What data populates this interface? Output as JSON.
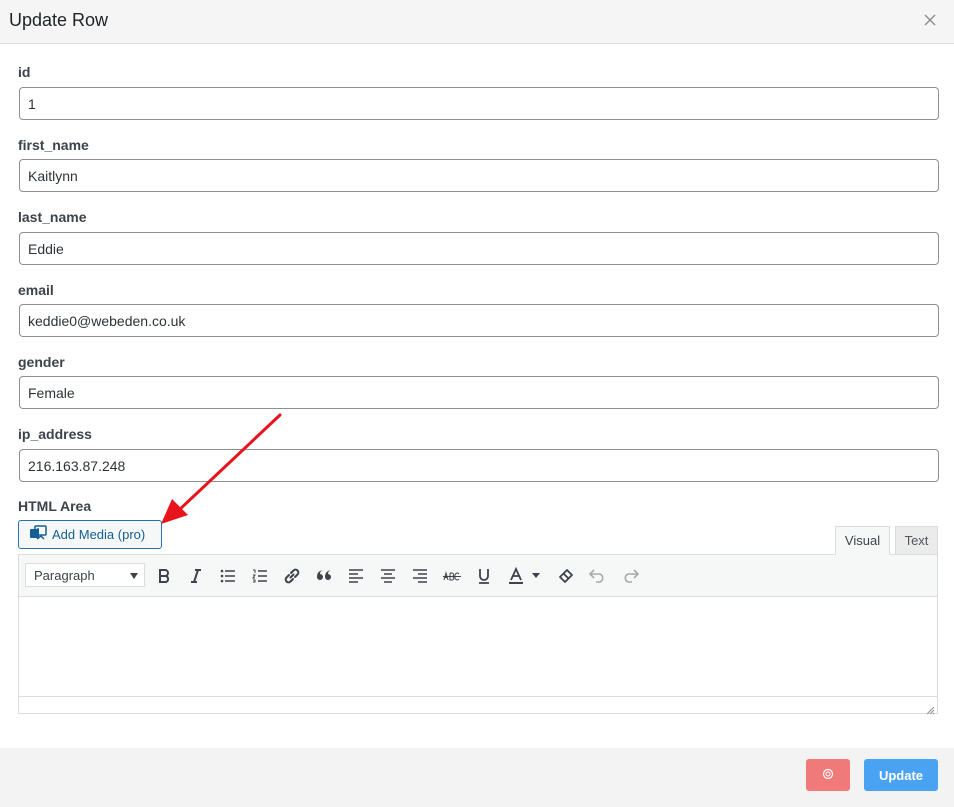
{
  "modal": {
    "title": "Update Row"
  },
  "fields": [
    {
      "label": "id",
      "value": "1"
    },
    {
      "label": "first_name",
      "value": "Kaitlynn"
    },
    {
      "label": "last_name",
      "value": "Eddie"
    },
    {
      "label": "email",
      "value": "keddie0@webeden.co.uk"
    },
    {
      "label": "gender",
      "value": "Female"
    },
    {
      "label": "ip_address",
      "value": "216.163.87.248"
    }
  ],
  "html_area": {
    "label": "HTML Area",
    "add_media_label": "Add Media (pro)",
    "tabs": {
      "visual": "Visual",
      "text": "Text"
    },
    "format_select": "Paragraph",
    "toolbar_icons": [
      "bold-icon",
      "italic-icon",
      "bullet-list-icon",
      "numbered-list-icon",
      "link-icon",
      "blockquote-icon",
      "align-left-icon",
      "align-center-icon",
      "align-right-icon",
      "strikethrough-icon",
      "underline-icon",
      "text-color-icon",
      "clear-formatting-icon",
      "undo-icon",
      "redo-icon"
    ]
  },
  "footer": {
    "update_label": "Update"
  },
  "colors": {
    "primary": "#4aa3f2",
    "danger": "#f07a7a",
    "link": "#135e96",
    "annotation_arrow": "#e8141b"
  }
}
